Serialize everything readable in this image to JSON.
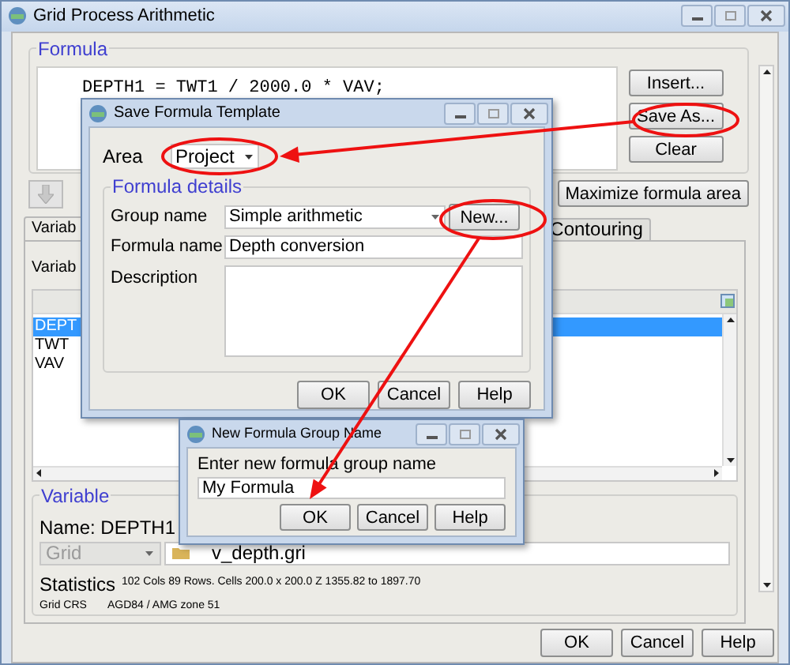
{
  "window": {
    "title": "Grid Process Arithmetic"
  },
  "formula": {
    "legend": "Formula",
    "text": "DEPTH1 = TWT1 / 2000.0 * VAV;",
    "buttons": [
      "Insert...",
      "Save As...",
      "Clear"
    ]
  },
  "maximize_button": "Maximize formula area",
  "tabs": [
    {
      "label": "Variab",
      "selected": true
    },
    {
      "label": "Contouring",
      "selected": false
    }
  ],
  "variables": {
    "label": "Variab",
    "rows": [
      {
        "name": "DEPT",
        "selected": true
      },
      {
        "name": "TWT",
        "selected": false
      },
      {
        "name": "VAV",
        "selected": false
      }
    ]
  },
  "variable": {
    "legend": "Variable",
    "name": "Name: DEPTH1",
    "type": "Grid",
    "type_disabled": true,
    "file": "v_depth.gri",
    "statistics_label": "Statistics",
    "statistics": "102 Cols 89 Rows. Cells 200.0 x 200.0  Z 1355.82 to 1897.70",
    "crs_label": "Grid CRS",
    "crs": "AGD84 / AMG zone 51"
  },
  "buttons": [
    "OK",
    "Cancel",
    "Help"
  ],
  "save_dialog": {
    "title": "Save Formula Template",
    "area_label": "Area",
    "area": "Project",
    "legend": "Formula details",
    "group_label": "Group name",
    "group": "Simple arithmetic",
    "new_button": "New...",
    "formula_label": "Formula name",
    "formula": "Depth conversion",
    "description_label": "Description",
    "buttons": [
      "OK",
      "Cancel",
      "Help"
    ]
  },
  "new_group_dialog": {
    "title": "New Formula Group Name",
    "prompt": "Enter new formula group name",
    "value": "My Formula",
    "buttons": [
      "OK",
      "Cancel",
      "Help"
    ]
  }
}
